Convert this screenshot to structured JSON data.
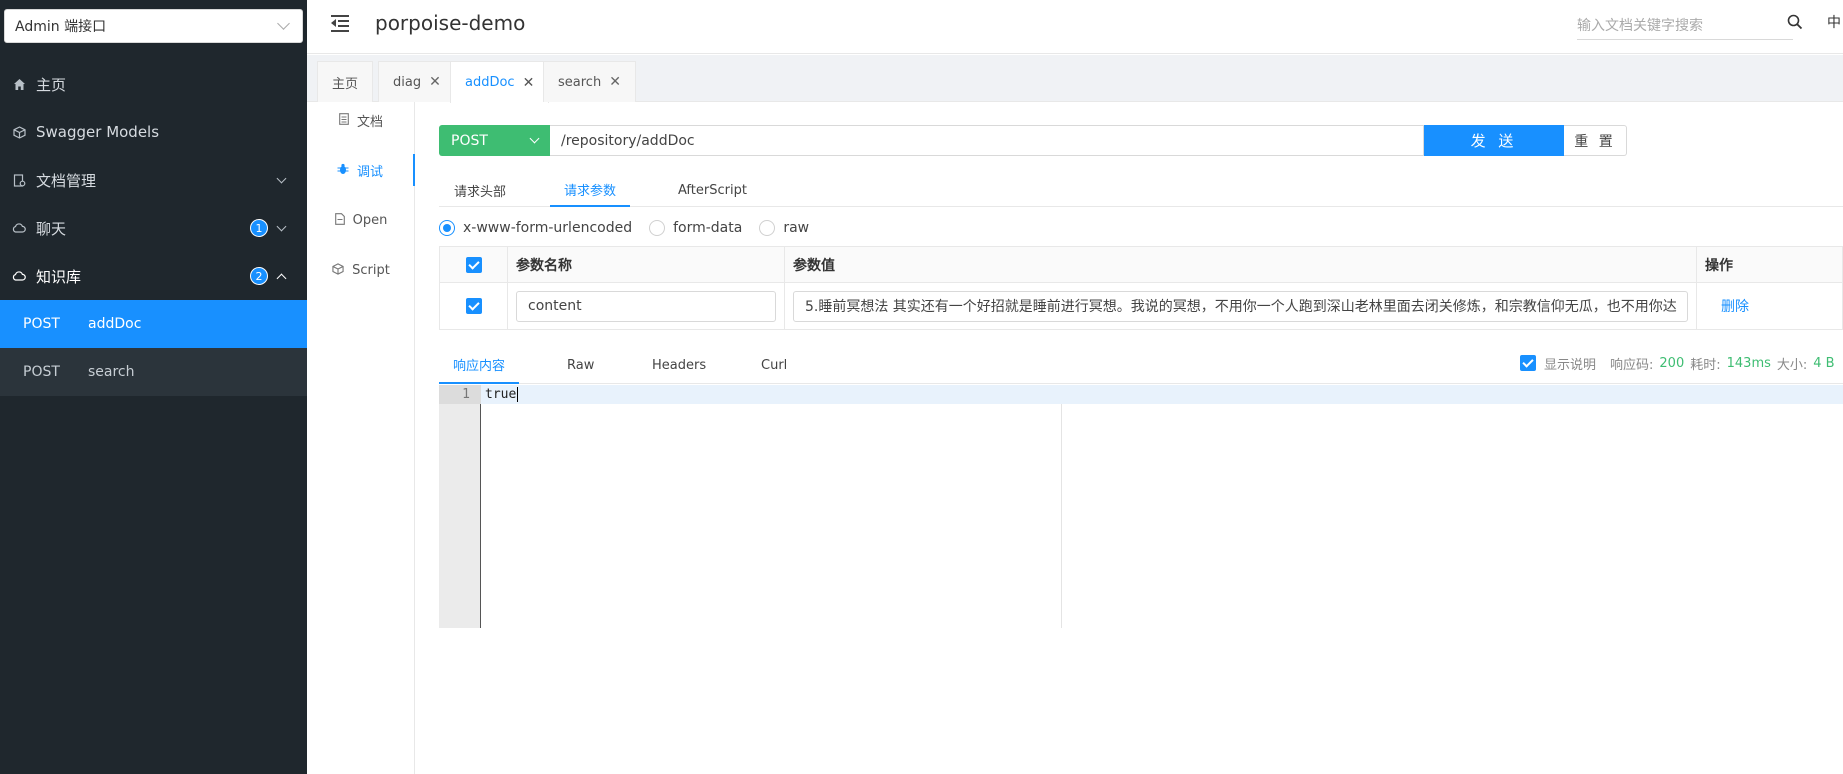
{
  "sidebar": {
    "group_select": "Admin 端接口",
    "items": [
      {
        "label": "主页",
        "icon": "home-icon"
      },
      {
        "label": "Swagger Models",
        "icon": "cube-icon"
      },
      {
        "label": "文档管理",
        "icon": "file-manage-icon"
      },
      {
        "label": "聊天",
        "icon": "cloud-icon",
        "badge": "1"
      },
      {
        "label": "知识库",
        "icon": "cloud-icon",
        "badge": "2"
      }
    ],
    "sub_items": [
      {
        "method": "POST",
        "name": "addDoc"
      },
      {
        "method": "POST",
        "name": "search"
      }
    ]
  },
  "header": {
    "title": "porpoise-demo",
    "search_placeholder": "输入文档关键字搜索",
    "lang": "中"
  },
  "tabs": [
    {
      "label": "主页"
    },
    {
      "label": "diag"
    },
    {
      "label": "addDoc"
    },
    {
      "label": "search"
    }
  ],
  "subnav": [
    {
      "label": "文档"
    },
    {
      "label": "调试"
    },
    {
      "label": "Open"
    },
    {
      "label": "Script"
    }
  ],
  "request": {
    "method": "POST",
    "url": "/repository/addDoc",
    "send_label": "发 送",
    "reset_label": "重 置"
  },
  "param_tabs": [
    "请求头部",
    "请求参数",
    "AfterScript"
  ],
  "content_types": [
    "x-www-form-urlencoded",
    "form-data",
    "raw"
  ],
  "param_table": {
    "headers": [
      "参数名称",
      "参数值",
      "操作"
    ],
    "rows": [
      {
        "name": "content",
        "value": "5.睡前冥想法 其实还有一个好招就是睡前进行冥想。我说的冥想，不用你一个人跑到深山老林里面去闭关修炼，和宗教信仰无瓜，也不用你达",
        "action": "删除"
      }
    ]
  },
  "response_tabs": [
    "响应内容",
    "Raw",
    "Headers",
    "Curl"
  ],
  "response_info": {
    "show_desc": "显示说明",
    "code_label": "响应码:",
    "code": "200",
    "time_label": "耗时:",
    "time": "143ms",
    "size_label": "大小:",
    "size": "4 B"
  },
  "editor": {
    "line_number": "1",
    "content": "true"
  },
  "colors": {
    "sidebar_bg": "#1f272d",
    "accent": "#1890ff",
    "method_green": "#3ebd72"
  }
}
